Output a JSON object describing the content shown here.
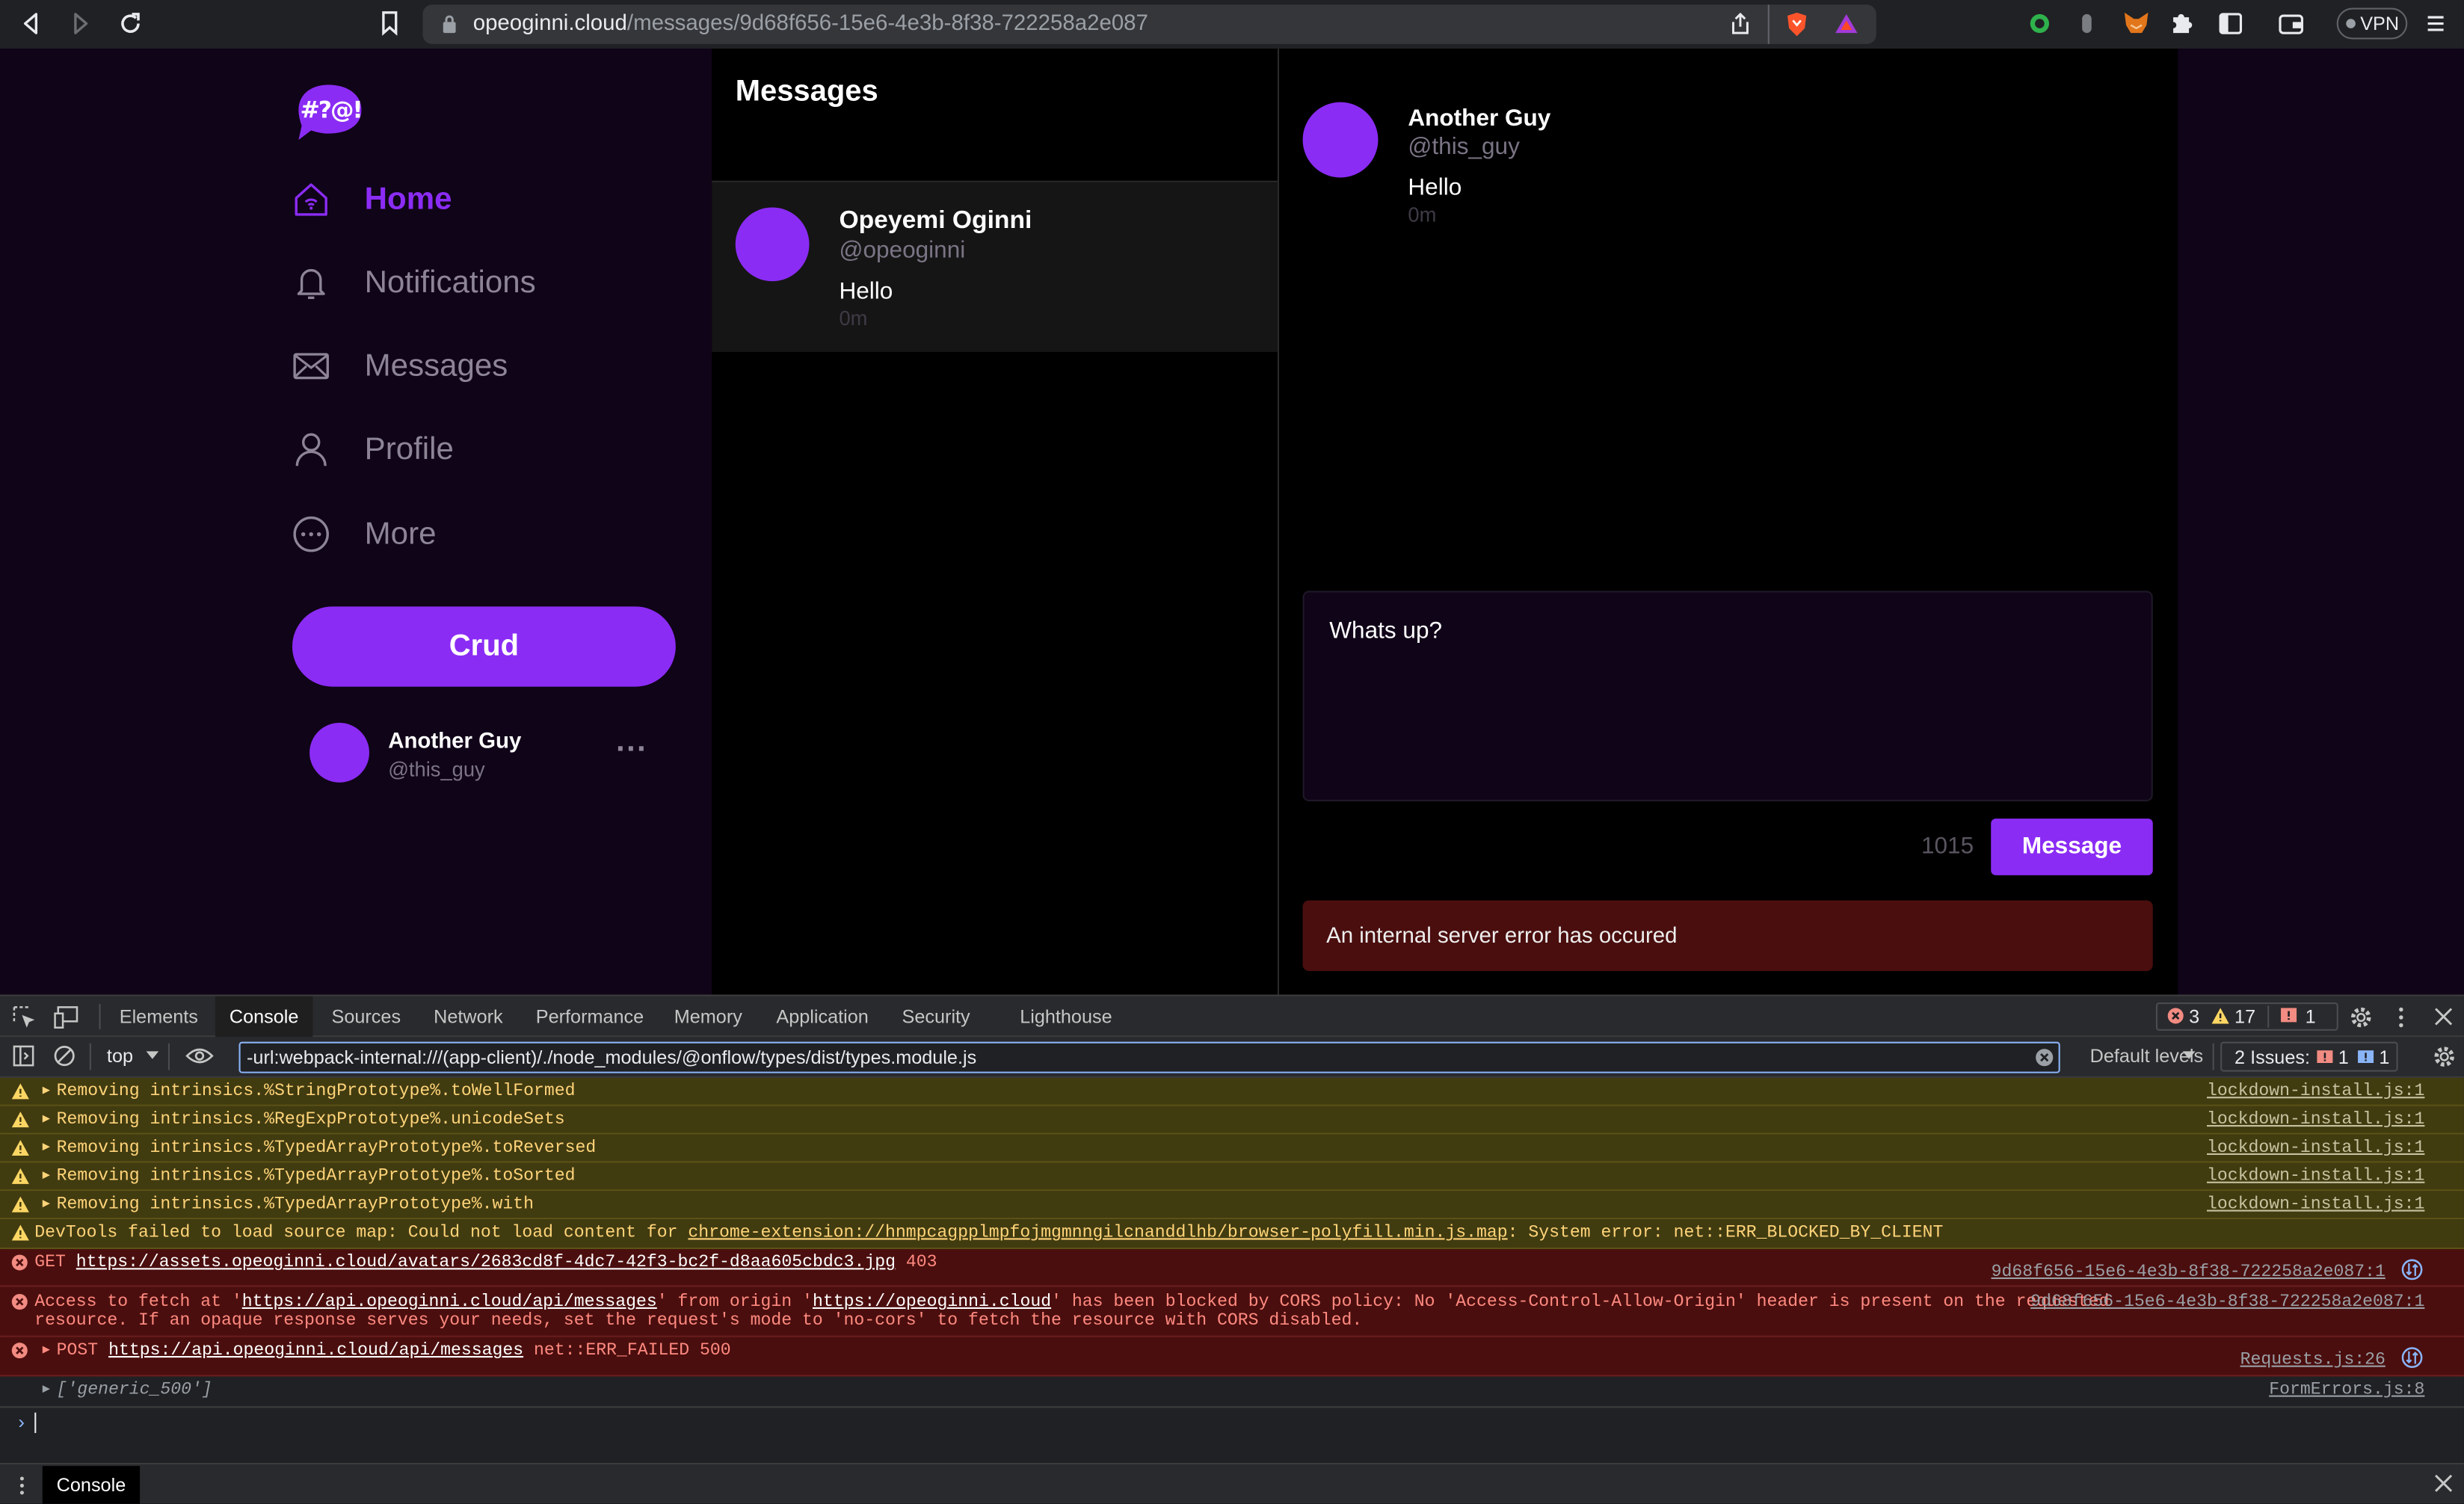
{
  "browser": {
    "url_host": "opeoginni.cloud",
    "url_path": "/messages/9d68f656-15e6-4e3b-8f38-722258a2e087",
    "vpn_label": "VPN"
  },
  "app": {
    "logo_text": "#?@!",
    "nav": [
      {
        "label": "Home",
        "icon": "home-icon"
      },
      {
        "label": "Notifications",
        "icon": "bell-icon"
      },
      {
        "label": "Messages",
        "icon": "mail-icon"
      },
      {
        "label": "Profile",
        "icon": "user-icon"
      },
      {
        "label": "More",
        "icon": "more-circle-icon"
      }
    ],
    "crud_button": "Crud",
    "account": {
      "name": "Another Guy",
      "handle": "@this_guy",
      "menu": "···"
    },
    "colors": {
      "accent": "#8b2cf5",
      "error": "#4a0e0e"
    }
  },
  "messages_panel": {
    "title": "Messages",
    "conversations": [
      {
        "name": "Opeyemi Oginni",
        "handle": "@opeoginni",
        "text": "Hello",
        "time": "0m"
      }
    ]
  },
  "thread": {
    "messages": [
      {
        "name": "Another Guy",
        "handle": "@this_guy",
        "text": "Hello",
        "time": "0m"
      }
    ],
    "composer_value": "Whats up?",
    "char_count": "1015",
    "send_button": "Message",
    "error_text": "An internal server error has occured"
  },
  "devtools": {
    "tabs": [
      "Elements",
      "Console",
      "Sources",
      "Network",
      "Performance",
      "Memory",
      "Application",
      "Security",
      "Lighthouse"
    ],
    "active_tab": "Console",
    "error_count": "3",
    "warning_count": "17",
    "issue_count": "1",
    "context": "top",
    "filter_value": "-url:webpack-internal:///(app-client)/./node_modules/@onflow/types/dist/types.module.js",
    "levels": "Default levels",
    "issues_label": "2 Issues:",
    "issues_err": "1",
    "issues_info": "1",
    "warnings": [
      {
        "text": "Removing intrinsics.%StringPrototype%.toWellFormed",
        "source": "lockdown-install.js:1"
      },
      {
        "text": "Removing intrinsics.%RegExpPrototype%.unicodeSets",
        "source": "lockdown-install.js:1"
      },
      {
        "text": "Removing intrinsics.%TypedArrayPrototype%.toReversed",
        "source": "lockdown-install.js:1"
      },
      {
        "text": "Removing intrinsics.%TypedArrayPrototype%.toSorted",
        "source": "lockdown-install.js:1"
      },
      {
        "text": "Removing intrinsics.%TypedArrayPrototype%.with",
        "source": "lockdown-install.js:1"
      }
    ],
    "sourcemap_warning": {
      "prefix": "DevTools failed to load source map: Could not load content for ",
      "link": "chrome-extension://hnmpcagpplmpfojmgmnngilcnanddlhb/browser-polyfill.min.js.map",
      "suffix": ": System error: net::ERR_BLOCKED_BY_CLIENT"
    },
    "get_error": {
      "method": "GET",
      "url": "https://assets.opeoginni.cloud/avatars/2683cd8f-4dc7-42f3-bc2f-d8aa605cbdc3.jpg",
      "status": "403",
      "source": "9d68f656-15e6-4e3b-8f38-722258a2e087:1"
    },
    "cors_error": {
      "p1": "Access to fetch at '",
      "url1": "https://api.opeoginni.cloud/api/messages",
      "p2": "' from origin '",
      "url2": "https://opeoginni.cloud",
      "p3": "' has been blocked by CORS policy: No 'Access-Control-Allow-Origin' header is present on the requested",
      "line2": "resource. If an opaque response serves your needs, set the request's mode to 'no-cors' to fetch the resource with CORS disabled.",
      "source": "9d68f656-15e6-4e3b-8f38-722258a2e087:1"
    },
    "post_error": {
      "method": "POST",
      "url": "https://api.opeoginni.cloud/api/messages",
      "status": "net::ERR_FAILED 500",
      "source": "Requests.js:26"
    },
    "log": {
      "text": "['generic_500']",
      "source": "FormErrors.js:8"
    },
    "drawer_tab": "Console"
  }
}
